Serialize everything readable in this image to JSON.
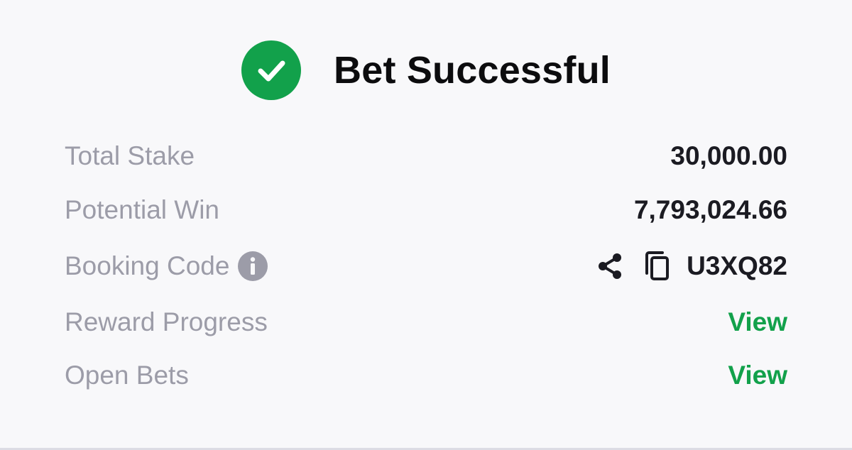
{
  "header": {
    "title": "Bet Successful",
    "icon": "check-circle-icon"
  },
  "colors": {
    "success": "#12a14b",
    "label": "#9c9ca8",
    "value": "#1b1b22",
    "link": "#12a14b",
    "background": "#f8f8fa"
  },
  "summary": {
    "total_stake": {
      "label": "Total Stake",
      "value": "30,000.00"
    },
    "potential_win": {
      "label": "Potential Win",
      "value": "7,793,024.66"
    },
    "booking_code": {
      "label": "Booking Code",
      "value": "U3XQ82",
      "icons": [
        "info-icon",
        "share-icon",
        "copy-icon"
      ]
    },
    "reward_progress": {
      "label": "Reward Progress",
      "value": "View"
    },
    "open_bets": {
      "label": "Open Bets",
      "value": "View"
    }
  }
}
